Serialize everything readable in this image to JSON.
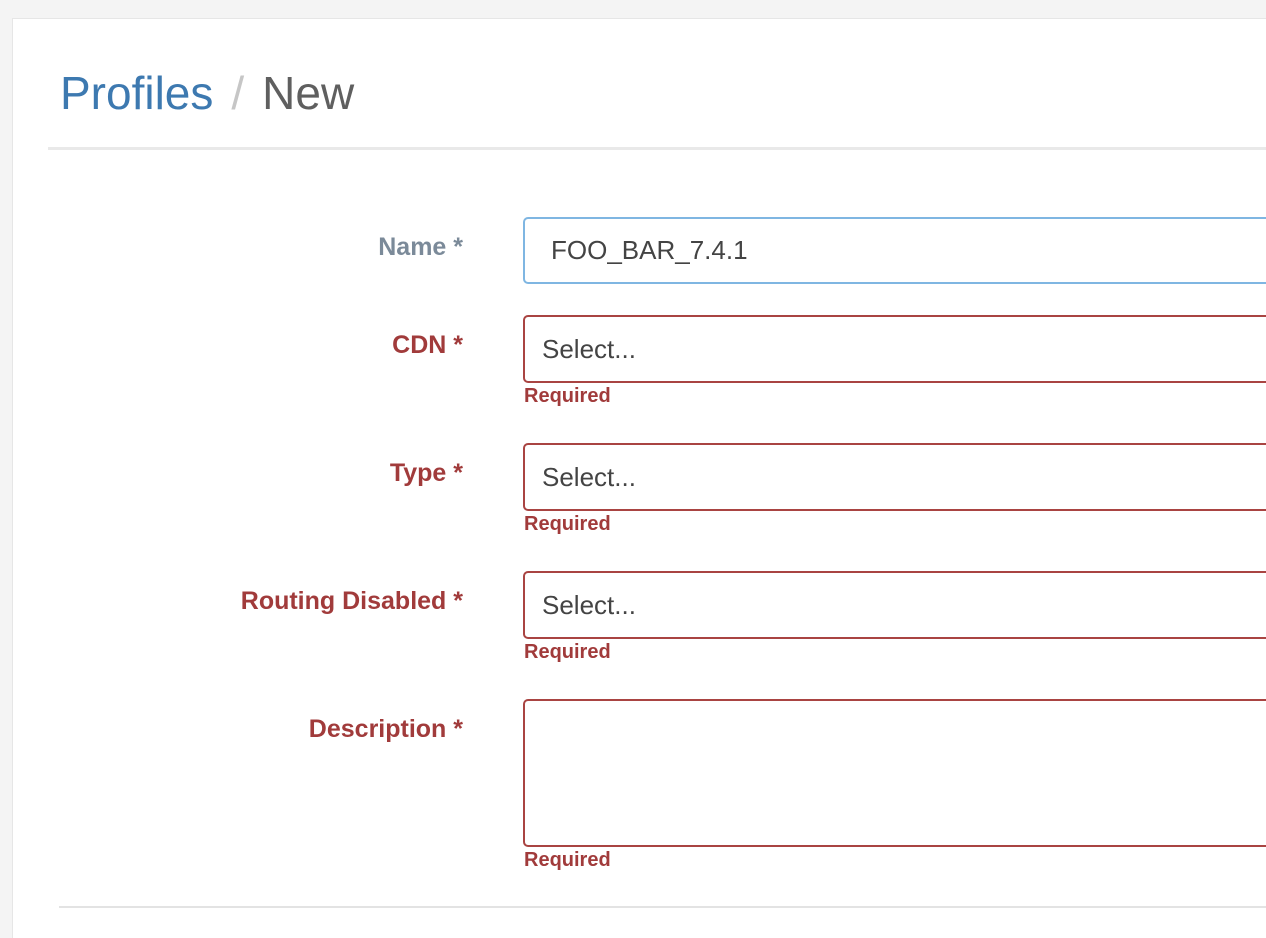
{
  "breadcrumb": {
    "parent": "Profiles",
    "separator": "/",
    "current": "New"
  },
  "form": {
    "name": {
      "label": "Name *",
      "value": "FOO_BAR_7.4.1"
    },
    "cdn": {
      "label": "CDN *",
      "placeholder": "Select...",
      "error": "Required"
    },
    "type": {
      "label": "Type *",
      "placeholder": "Select...",
      "error": "Required"
    },
    "routing_disabled": {
      "label": "Routing Disabled *",
      "placeholder": "Select...",
      "error": "Required"
    },
    "description": {
      "label": "Description *",
      "value": "",
      "error": "Required"
    }
  },
  "colors": {
    "link": "#3d79b0",
    "error": "#a13b3b",
    "focus_border": "#7fb6e2"
  }
}
